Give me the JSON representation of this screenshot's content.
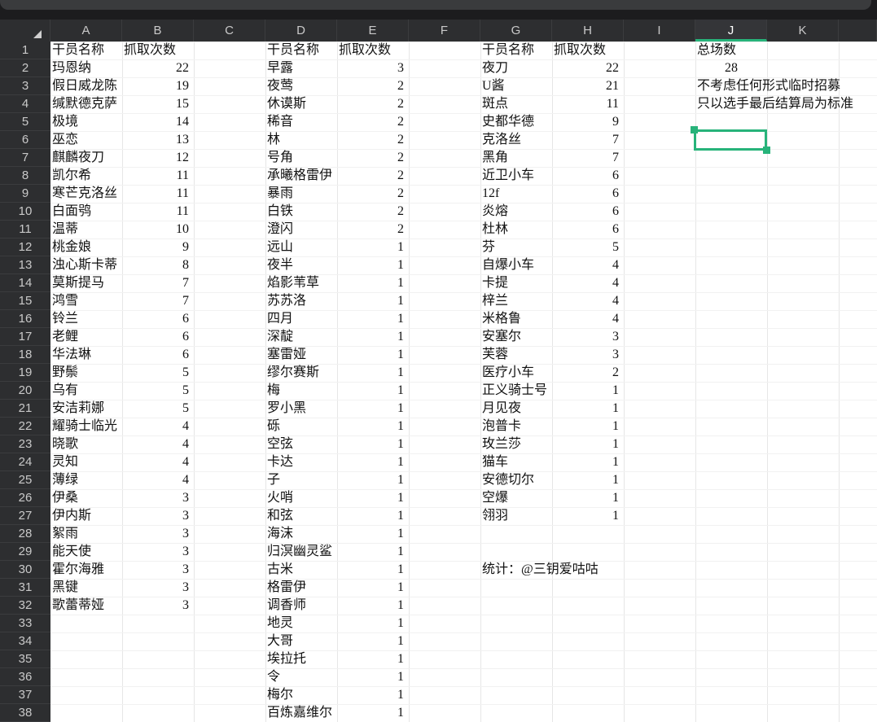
{
  "columns": [
    "A",
    "B",
    "C",
    "D",
    "E",
    "F",
    "G",
    "H",
    "I",
    "J",
    "K"
  ],
  "rows": [
    "1",
    "2",
    "3",
    "4",
    "5",
    "6",
    "7",
    "8",
    "9",
    "10",
    "11",
    "12",
    "13",
    "14",
    "15",
    "16",
    "17",
    "18",
    "19",
    "20",
    "21",
    "22",
    "23",
    "24",
    "25",
    "26",
    "27",
    "28",
    "29",
    "30",
    "31",
    "32",
    "33",
    "34",
    "35",
    "36",
    "37",
    "38"
  ],
  "selected_column": "J",
  "selected_row": "6",
  "headers": {
    "A": "干员名称",
    "B": "抓取次数",
    "D": "干员名称",
    "E": "抓取次数",
    "G": "干员名称",
    "H": "抓取次数",
    "J": "总场数"
  },
  "table1": [
    [
      "玛恩纳",
      "22"
    ],
    [
      "假日威龙陈",
      "19"
    ],
    [
      "缄默德克萨",
      "15"
    ],
    [
      "极境",
      "14"
    ],
    [
      "巫恋",
      "13"
    ],
    [
      "麒麟夜刀",
      "12"
    ],
    [
      "凯尔希",
      "11"
    ],
    [
      "寒芒克洛丝",
      "11"
    ],
    [
      "白面鸮",
      "11"
    ],
    [
      "温蒂",
      "10"
    ],
    [
      "桃金娘",
      "9"
    ],
    [
      "浊心斯卡蒂",
      "8"
    ],
    [
      "莫斯提马",
      "7"
    ],
    [
      "鸿雪",
      "7"
    ],
    [
      "铃兰",
      "6"
    ],
    [
      "老鲤",
      "6"
    ],
    [
      "华法琳",
      "6"
    ],
    [
      "野鬃",
      "5"
    ],
    [
      "乌有",
      "5"
    ],
    [
      "安洁莉娜",
      "5"
    ],
    [
      "耀骑士临光",
      "4"
    ],
    [
      "晓歌",
      "4"
    ],
    [
      "灵知",
      "4"
    ],
    [
      "薄绿",
      "4"
    ],
    [
      "伊桑",
      "3"
    ],
    [
      "伊内斯",
      "3"
    ],
    [
      "絮雨",
      "3"
    ],
    [
      "能天使",
      "3"
    ],
    [
      "霍尔海雅",
      "3"
    ],
    [
      "黑键",
      "3"
    ],
    [
      "歌蕾蒂娅",
      "3"
    ]
  ],
  "table2": [
    [
      "早露",
      "3"
    ],
    [
      "夜莺",
      "2"
    ],
    [
      "休谟斯",
      "2"
    ],
    [
      "稀音",
      "2"
    ],
    [
      "林",
      "2"
    ],
    [
      "号角",
      "2"
    ],
    [
      "承曦格雷伊",
      "2"
    ],
    [
      "暴雨",
      "2"
    ],
    [
      "白铁",
      "2"
    ],
    [
      "澄闪",
      "2"
    ],
    [
      "远山",
      "1"
    ],
    [
      "夜半",
      "1"
    ],
    [
      "焰影苇草",
      "1"
    ],
    [
      "苏苏洛",
      "1"
    ],
    [
      "四月",
      "1"
    ],
    [
      "深靛",
      "1"
    ],
    [
      "塞雷娅",
      "1"
    ],
    [
      "缪尔赛斯",
      "1"
    ],
    [
      "梅",
      "1"
    ],
    [
      "罗小黑",
      "1"
    ],
    [
      "砾",
      "1"
    ],
    [
      "空弦",
      "1"
    ],
    [
      "卡达",
      "1"
    ],
    [
      "子",
      "1"
    ],
    [
      "火哨",
      "1"
    ],
    [
      "和弦",
      "1"
    ],
    [
      "海沫",
      "1"
    ],
    [
      "归溟幽灵鲨",
      "1"
    ],
    [
      "古米",
      "1"
    ],
    [
      "格雷伊",
      "1"
    ],
    [
      "调香师",
      "1"
    ],
    [
      "地灵",
      "1"
    ],
    [
      "大哥",
      "1"
    ],
    [
      "埃拉托",
      "1"
    ],
    [
      "令",
      "1"
    ],
    [
      "梅尔",
      "1"
    ],
    [
      "百炼嘉维尔",
      "1"
    ]
  ],
  "table3": [
    [
      "夜刀",
      "22"
    ],
    [
      "U酱",
      "21"
    ],
    [
      "斑点",
      "11"
    ],
    [
      "史都华德",
      "9"
    ],
    [
      "克洛丝",
      "7"
    ],
    [
      "黑角",
      "7"
    ],
    [
      "近卫小车",
      "6"
    ],
    [
      "12f",
      "6"
    ],
    [
      "炎熔",
      "6"
    ],
    [
      "杜林",
      "6"
    ],
    [
      "芬",
      "5"
    ],
    [
      "自爆小车",
      "4"
    ],
    [
      "卡提",
      "4"
    ],
    [
      "梓兰",
      "4"
    ],
    [
      "米格鲁",
      "4"
    ],
    [
      "安塞尔",
      "3"
    ],
    [
      "芙蓉",
      "3"
    ],
    [
      "医疗小车",
      "2"
    ],
    [
      "正义骑士号",
      "1"
    ],
    [
      "月见夜",
      "1"
    ],
    [
      "泡普卡",
      "1"
    ],
    [
      "玫兰莎",
      "1"
    ],
    [
      "猫车",
      "1"
    ],
    [
      "安德切尔",
      "1"
    ],
    [
      "空爆",
      "1"
    ],
    [
      "翎羽",
      "1"
    ]
  ],
  "total_value": "28",
  "note1": "不考虑任何形式临时招募",
  "note2": "只以选手最后结算局为标准",
  "credit": "统计：@三钥爱咕咕",
  "colors": {
    "accent": "#27b37a",
    "header_bg": "#2d2e30"
  }
}
